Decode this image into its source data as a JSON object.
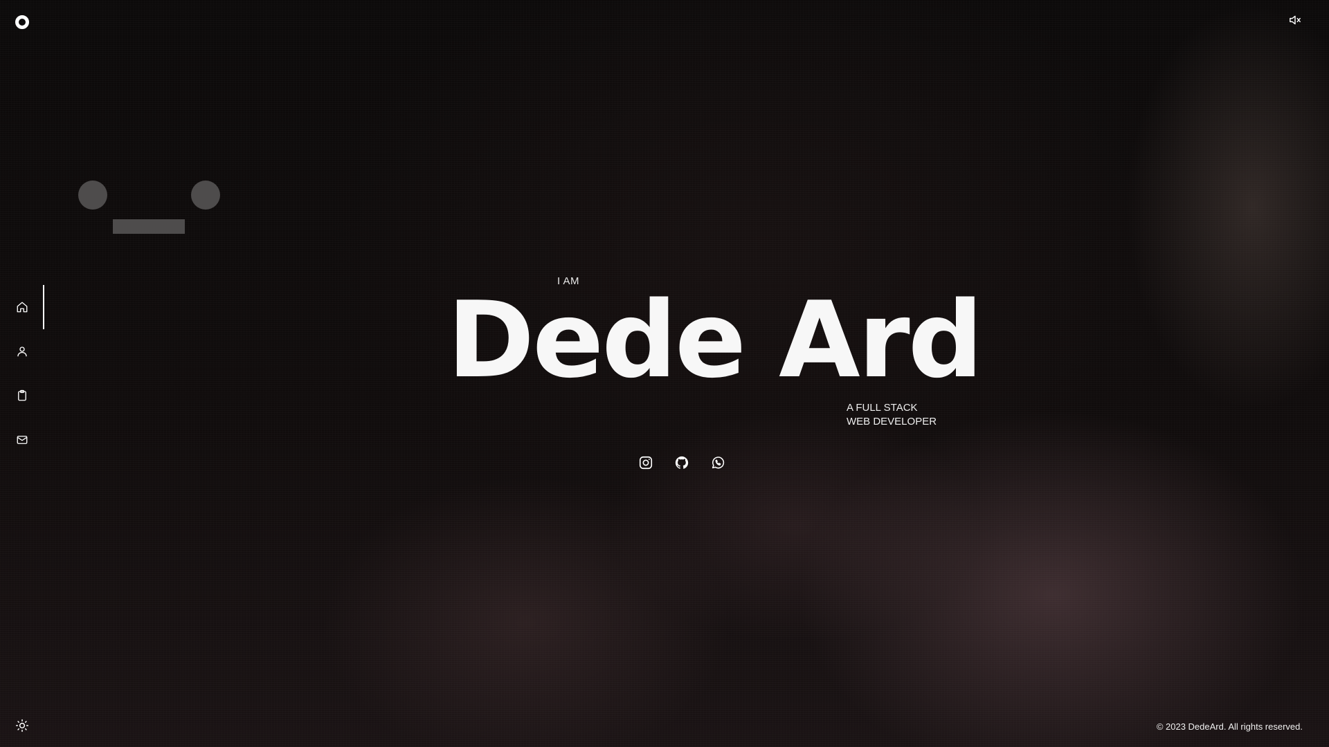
{
  "header": {
    "logo_icon": "ring-logo-icon",
    "sound_icon": "speaker-muted-icon"
  },
  "decoration": {
    "face_color": "#4e4c4c"
  },
  "sidebar": {
    "items": [
      {
        "icon": "home-icon",
        "active": true
      },
      {
        "icon": "user-icon",
        "active": false
      },
      {
        "icon": "clipboard-icon",
        "active": false
      },
      {
        "icon": "mail-icon",
        "active": false
      }
    ],
    "theme_icon": "sun-icon"
  },
  "hero": {
    "intro": "I AM",
    "name": "Dede Ard",
    "role_line1": "A FULL STACK",
    "role_line2": "WEB DEVELOPER"
  },
  "socials": [
    {
      "icon": "instagram-icon"
    },
    {
      "icon": "github-icon"
    },
    {
      "icon": "whatsapp-icon"
    }
  ],
  "footer": {
    "copyright": "© 2023 DedeArd. All rights reserved."
  },
  "colors": {
    "background": "#0b0909",
    "text": "#f2f2f2",
    "accent": "#ffffff"
  }
}
